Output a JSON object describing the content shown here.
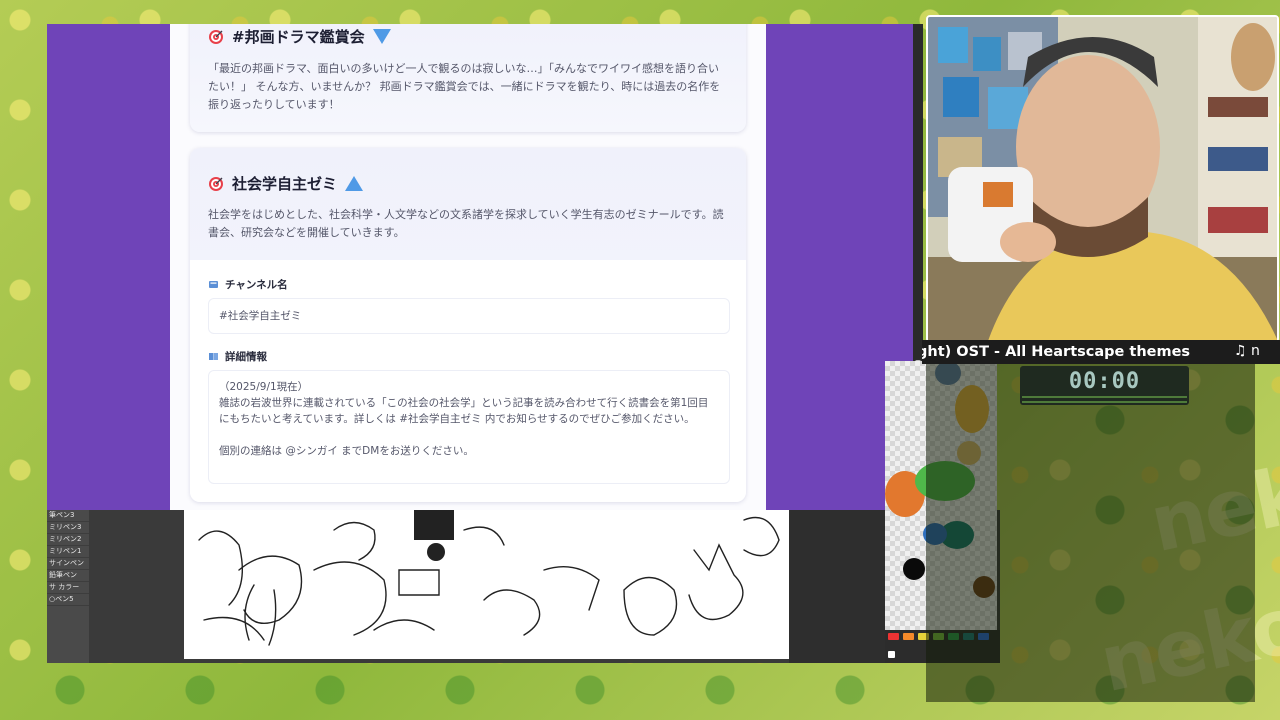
{
  "cards": {
    "drama": {
      "title": "#邦画ドラマ鑑賞会",
      "description": "「最近の邦画ドラマ、面白いの多いけど一人で観るのは寂しいな…」「みんなでワイワイ感想を語り合いたい！」 そんな方、いませんか？ 邦画ドラマ鑑賞会では、一緒にドラマを観たり、時には過去の名作を振り返ったりしています！"
    },
    "sociology": {
      "title": "社会学自主ゼミ",
      "description": "社会学をはじめとした、社会科学・人文学などの文系諸学を探求していく学生有志のゼミナールです。読書会、研究会などを開催していきます。",
      "channel_label": "チャンネル名",
      "channel_value": "#社会学自主ゼミ",
      "details_label": "詳細情報",
      "details_lines": [
        "（2025/9/1現在）",
        "雑誌の岩波世界に連載されている「この社会の社会学」という記事を読み合わせて行く読書会を第1回目",
        "にもちたいと考えています。詳しくは #社会学自主ゼミ 内でお知らせするのでぜひご参加ください。",
        "",
        "個別の連絡は @シンガイ までDMをお送りください。"
      ]
    }
  },
  "drawing_app": {
    "tool_rows": [
      "筆ペン3",
      "ミリペン3",
      "ミリペン2",
      "ミリペン1",
      "サインペン",
      "鉛筆ペン",
      "サ カラー",
      "○ペン5",
      ""
    ]
  },
  "stream": {
    "now_playing": "ght) OST - All Heartscape themes",
    "music_icon": "♫ n",
    "timer": "00:00"
  },
  "colors": {
    "browser_bg": "#6f44b8",
    "accent_triangle": "#4f9ae6"
  }
}
